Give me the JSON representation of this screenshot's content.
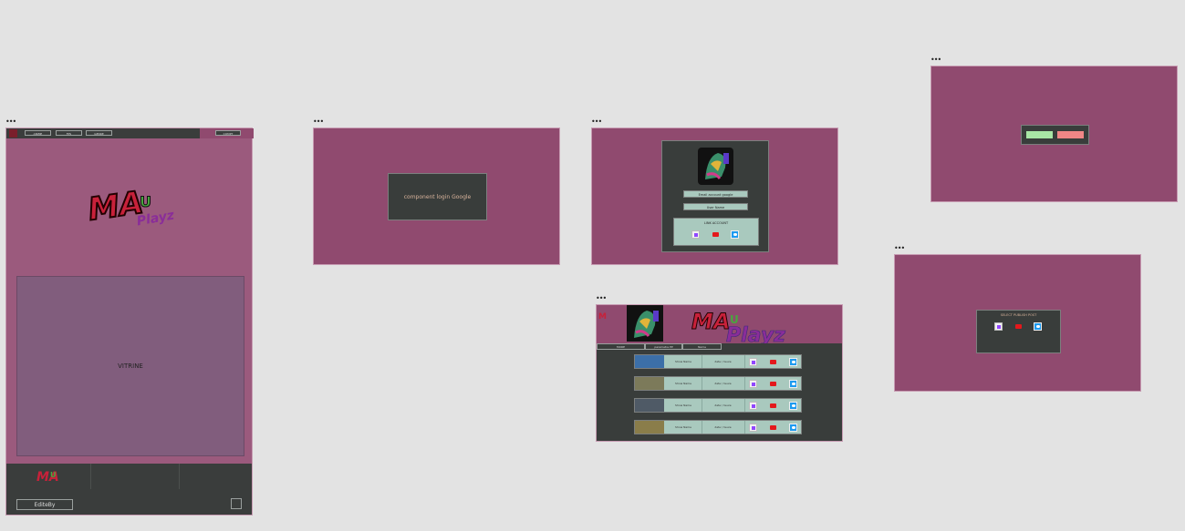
{
  "frame1": {
    "nav": [
      "ANIME",
      "FPS",
      "GENRE"
    ],
    "right_button": "COMPT",
    "vitrine": "VITRINE",
    "edited_by": "EditeBy"
  },
  "frame2": {
    "login_label": "component login Google"
  },
  "frame3": {
    "email_button": "Email account google",
    "name_button": "User Name",
    "link_account": "LINK ACCOUNT"
  },
  "frame4": {
    "confirm_color": "#a8e6a5",
    "cancel_color": "#f08686"
  },
  "frame5": {
    "title": "SELECT PUBLISH POST"
  },
  "frame6": {
    "tabs": [
      "MORE",
      "parametre PP",
      "Name"
    ],
    "rows": [
      {
        "title": "Show Name",
        "date": "date / heure"
      },
      {
        "title": "Show Name",
        "date": "date / heure"
      },
      {
        "title": "Show Name",
        "date": "date / heure"
      },
      {
        "title": "Show Name",
        "date": "date / heure"
      }
    ]
  },
  "logo": {
    "text": "MAU",
    "sub": "Playz"
  },
  "icons": [
    "twitch-icon",
    "youtube-icon",
    "twitter-icon"
  ]
}
